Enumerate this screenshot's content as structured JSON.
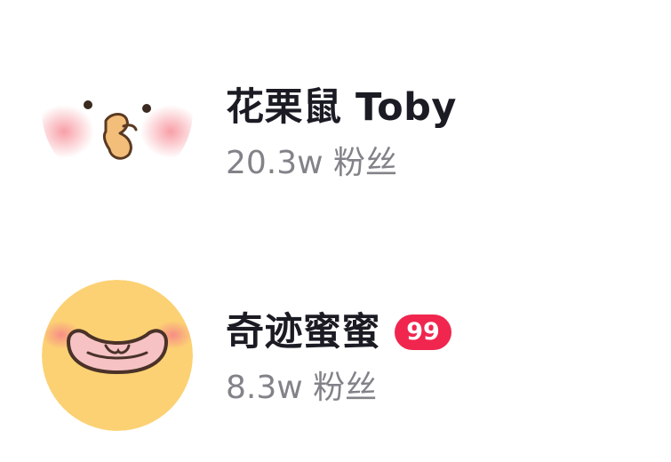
{
  "users": [
    {
      "name": "花栗鼠 Toby",
      "fans": "20.3w 粉丝",
      "avatar_icon": "chipmunk-face-icon"
    },
    {
      "name": "奇迹蜜蜜",
      "badge": "99",
      "fans": "8.3w 粉丝",
      "avatar_icon": "grinning-face-icon"
    }
  ],
  "colors": {
    "name_text": "#1b1b24",
    "fans_text": "#828289",
    "badge_bg": "#f0264f",
    "avatar_yellow": "#fcd173"
  }
}
